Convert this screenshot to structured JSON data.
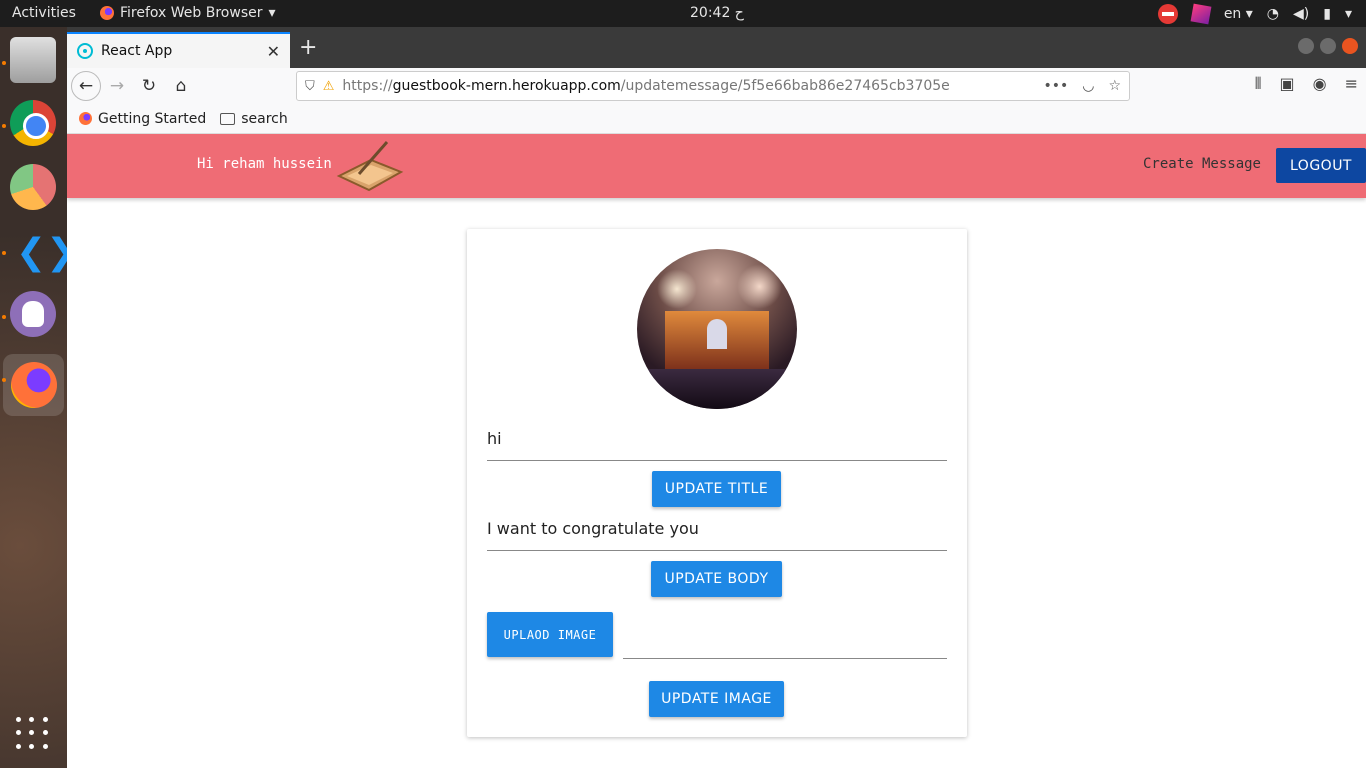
{
  "os": {
    "activities": "Activities",
    "app_name": "Firefox Web Browser",
    "clock": "20:42 ح",
    "language": "en"
  },
  "browser": {
    "tab_title": "React App",
    "url_scheme": "https://",
    "url_host": "guestbook-mern.herokuapp.com",
    "url_path": "/updatemessage/5f5e66bab86e27465cb3705e",
    "bookmarks": [
      "Getting Started",
      "search"
    ]
  },
  "appbar": {
    "greeting": "Hi reham hussein",
    "create_link": "Create Message",
    "logout": "LOGOUT",
    "color": "#ef6c75"
  },
  "form": {
    "title_value": "hi",
    "update_title": "UPDATE TITLE",
    "body_value": "I want to congratulate you",
    "update_body": "UPDATE BODY",
    "upload_image": "UPLAOD IMAGE",
    "update_image": "UPDATE IMAGE",
    "button_color": "#1e88e5"
  }
}
